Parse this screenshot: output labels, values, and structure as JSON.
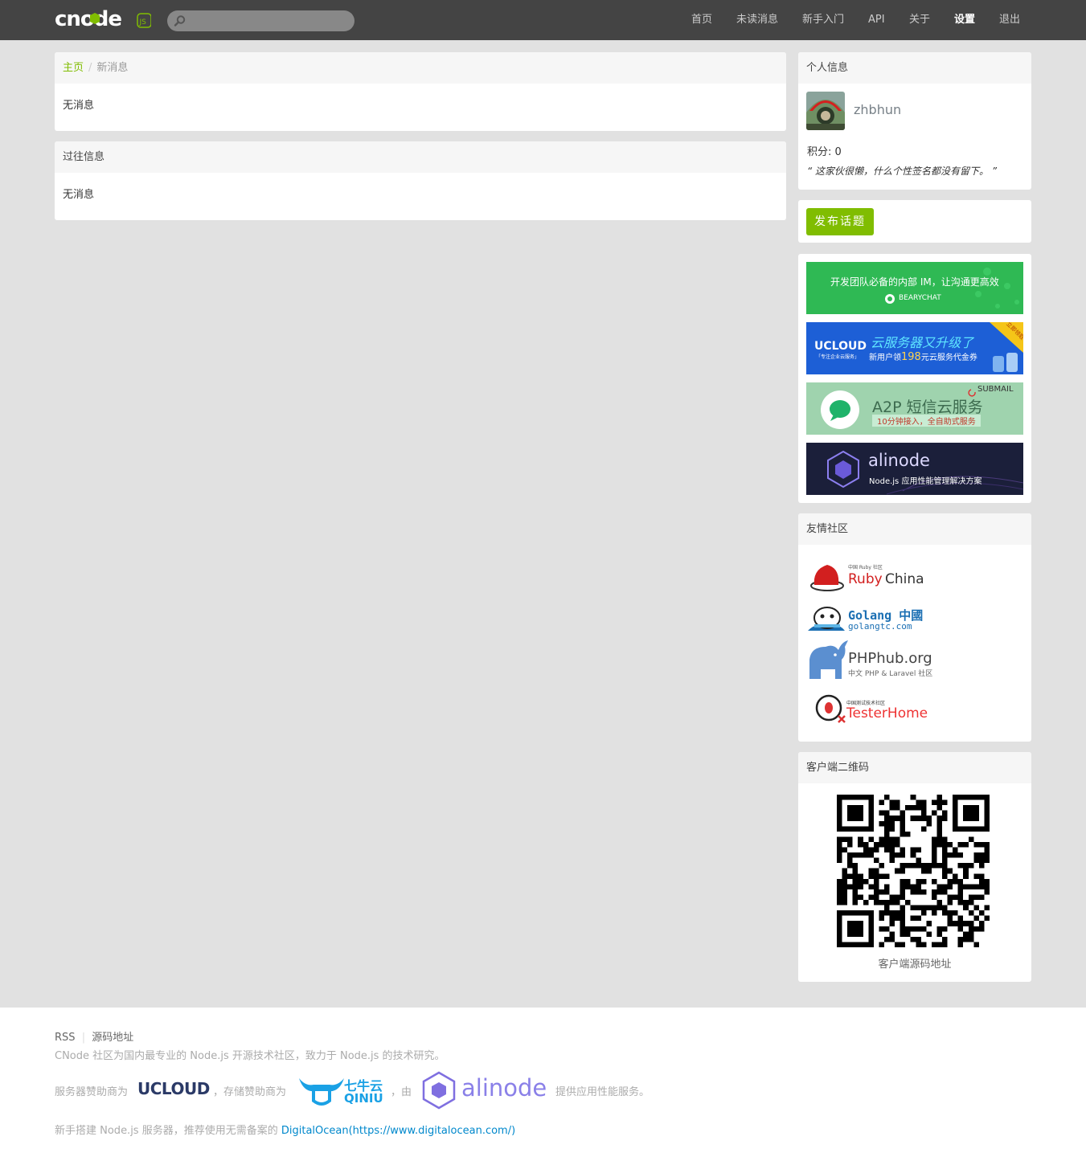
{
  "header": {
    "logo_text": "cnode",
    "logo_badge": "JS",
    "search": {
      "placeholder": "",
      "value": ""
    },
    "nav": [
      "首页",
      "未读消息",
      "新手入门",
      "API",
      "关于",
      "设置",
      "退出"
    ]
  },
  "main": {
    "breadcrumb": {
      "home": "主页",
      "separator": "/",
      "current": "新消息"
    },
    "new_messages": {
      "empty": "无消息"
    },
    "past_messages": {
      "title": "过往信息",
      "empty": "无消息"
    }
  },
  "sidebar": {
    "profile": {
      "title": "个人信息",
      "username": "zhbhun",
      "score": "积分: 0",
      "signature": "“ 这家伙很懒，什么个性签名都没有留下。 ”"
    },
    "publish_button": "发布话题",
    "ads": [
      {
        "name": "bearychat",
        "line1": "开发团队必备的内部 IM，让沟通更高效",
        "line2": "BEARYCHAT",
        "color": "#2fb954"
      },
      {
        "name": "ucloud",
        "brand": "UCLOUD",
        "tagline": "「专注企业云服务」",
        "headline": "云服务器又升级了",
        "subline_pre": "新用户领",
        "amount": "198",
        "subline_post": "元云服务代金券",
        "corner": "立即领取",
        "color": "#1d5fd6"
      },
      {
        "name": "submail",
        "brand": "SUBMAIL",
        "headline": "A2P 短信云服务",
        "subline": "10分钟接入，全自助式服务",
        "color": "#9fd3ae"
      },
      {
        "name": "alinode",
        "brand": "alinode",
        "subline": "Node.js 应用性能管理解决方案",
        "color": "#1b1f3a"
      }
    ],
    "friends": {
      "title": "友情社区",
      "items": [
        {
          "name": "ruby-china",
          "small": "中国 Ruby 社区",
          "label_a": "Ruby",
          "label_b": "China"
        },
        {
          "name": "golang",
          "label_a": "Golang 中國",
          "label_b": "golangtc.com"
        },
        {
          "name": "phphub",
          "label_a": "PHPhub.org",
          "label_b": "中文 PHP & Laravel 社区"
        },
        {
          "name": "testerhome",
          "small": "中国测试技术社区",
          "label_a": "TesterHome"
        }
      ]
    },
    "qrcode": {
      "title": "客户端二维码",
      "link": "客户端源码地址"
    }
  },
  "footer": {
    "links": [
      "RSS",
      "源码地址"
    ],
    "divider": "|",
    "about": "CNode 社区为国内最专业的 Node.js 开源技术社区，致力于 Node.js 的技术研究。",
    "sponsor_1": "服务器赞助商为",
    "sponsor_ucloud": "UCLOUD",
    "sponsor_2": "，存储赞助商为",
    "sponsor_qiniu_cn": "七牛云",
    "sponsor_qiniu_en": "QINIU",
    "sponsor_3": "，由",
    "sponsor_alinode": "alinode",
    "sponsor_4": "提供应用性能服务。",
    "host_text": "新手搭建 Node.js 服务器，推荐使用无需备案的",
    "host_link": "DigitalOcean(https://www.digitalocean.com/)"
  },
  "colors": {
    "brand_green": "#80bd01",
    "navbar": "#444444",
    "link_blue": "#0088cc"
  }
}
